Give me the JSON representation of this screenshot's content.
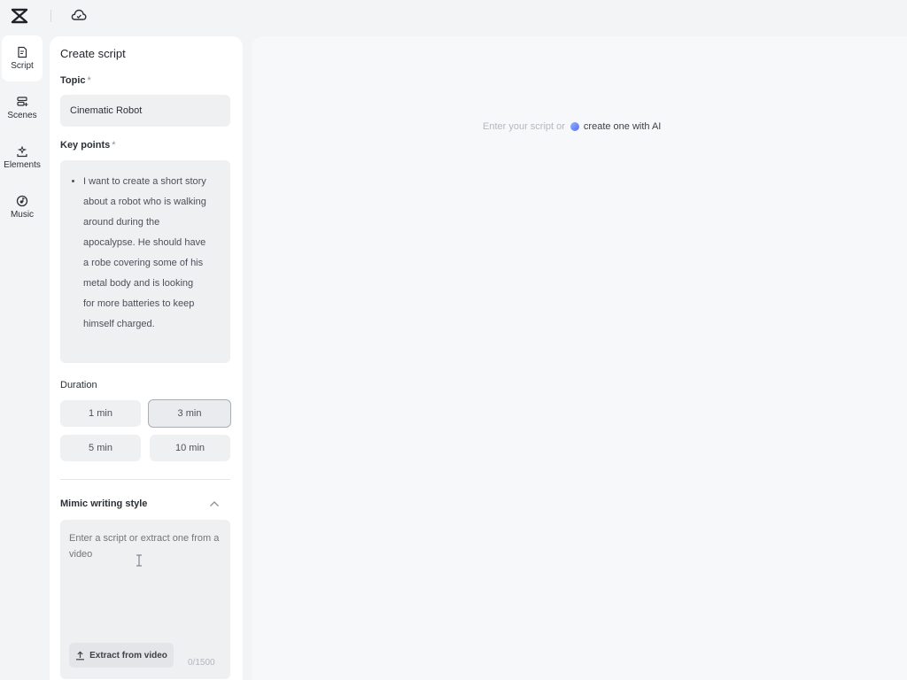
{
  "topbar": {
    "logo_icon": "capcut-logo",
    "cloud_icon": "cloud-icon"
  },
  "rail": {
    "items": [
      {
        "label": "Script",
        "icon": "script-icon",
        "active": true
      },
      {
        "label": "Scenes",
        "icon": "scenes-icon",
        "active": false
      },
      {
        "label": "Elements",
        "icon": "elements-icon",
        "active": false
      },
      {
        "label": "Music",
        "icon": "music-icon",
        "active": false
      }
    ]
  },
  "panel": {
    "title": "Create script",
    "topic": {
      "label": "Topic",
      "required_mark": "*",
      "value": "Cinematic Robot"
    },
    "key_points": {
      "label": "Key points",
      "required_mark": "*",
      "lines": [
        "I want to create a short story",
        "about a robot who is walking",
        "around during the",
        "apocalypse. He should have",
        "a robe covering some of his",
        "metal body and is looking",
        "for more batteries to keep",
        "himself charged."
      ]
    },
    "duration": {
      "label": "Duration",
      "options": [
        "1 min",
        "3 min",
        "5 min",
        "10 min"
      ],
      "selected": "3 min"
    },
    "mimic": {
      "label": "Mimic writing style",
      "placeholder": "Enter a script or extract one from a video",
      "extract_label": "Extract from video",
      "counter": "0/1500"
    }
  },
  "canvas": {
    "hint_prefix": "Enter your script or",
    "hint_link": "create one with AI"
  },
  "colors": {
    "background": "#f3f4f6",
    "panel": "#ffffff",
    "input": "#eff0f2",
    "ai_accent": "#5b6cf5"
  }
}
